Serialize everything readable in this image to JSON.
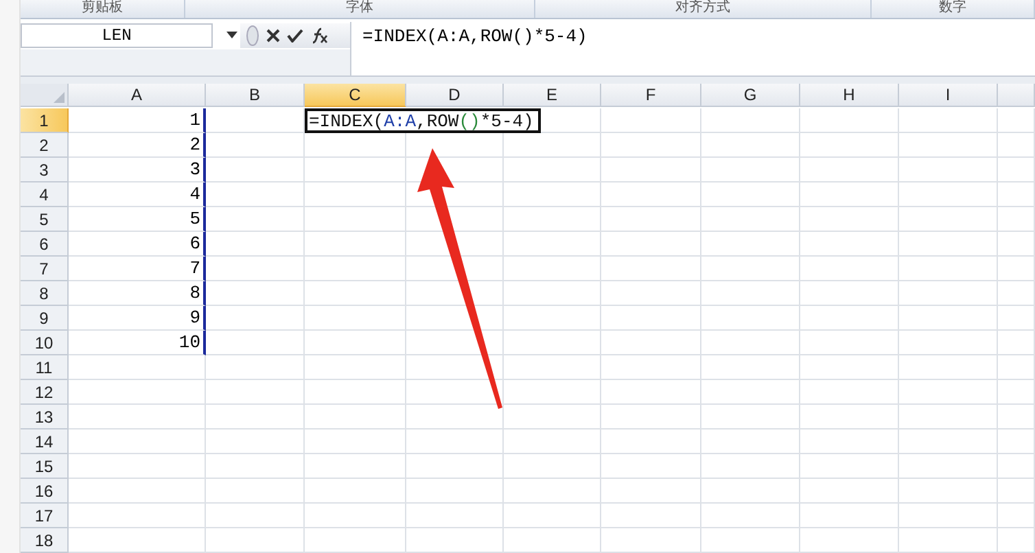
{
  "ribbon_groups": [
    "剪贴板",
    "字体",
    "对齐方式",
    "数字"
  ],
  "name_box": {
    "value": "LEN"
  },
  "formula_bar": {
    "value": "=INDEX(A:A,ROW()*5-4)"
  },
  "columns": [
    {
      "label": "A",
      "selected": false,
      "referenced": true
    },
    {
      "label": "B",
      "selected": false,
      "referenced": false
    },
    {
      "label": "C",
      "selected": true,
      "referenced": false
    },
    {
      "label": "D",
      "selected": false,
      "referenced": false
    },
    {
      "label": "E",
      "selected": false,
      "referenced": false
    },
    {
      "label": "F",
      "selected": false,
      "referenced": false
    },
    {
      "label": "G",
      "selected": false,
      "referenced": false
    },
    {
      "label": "H",
      "selected": false,
      "referenced": false
    },
    {
      "label": "I",
      "selected": false,
      "referenced": false
    }
  ],
  "rows": [
    {
      "label": "1",
      "selected": true,
      "cells": [
        {
          "kind": "value",
          "text": "1"
        },
        {
          "kind": "empty"
        },
        {
          "kind": "formula",
          "parts": [
            {
              "kind": "plain",
              "text": "=INDEX("
            },
            {
              "kind": "ref",
              "text": "A:A"
            },
            {
              "kind": "plain",
              "text": ",ROW"
            },
            {
              "kind": "paren",
              "text": "()"
            },
            {
              "kind": "plain",
              "text": "*5-4)"
            }
          ]
        }
      ]
    },
    {
      "label": "2",
      "selected": false,
      "cells": [
        {
          "kind": "value",
          "text": "2"
        }
      ]
    },
    {
      "label": "3",
      "selected": false,
      "cells": [
        {
          "kind": "value",
          "text": "3"
        }
      ]
    },
    {
      "label": "4",
      "selected": false,
      "cells": [
        {
          "kind": "value",
          "text": "4"
        }
      ]
    },
    {
      "label": "5",
      "selected": false,
      "cells": [
        {
          "kind": "value",
          "text": "5"
        }
      ]
    },
    {
      "label": "6",
      "selected": false,
      "cells": [
        {
          "kind": "value",
          "text": "6"
        }
      ]
    },
    {
      "label": "7",
      "selected": false,
      "cells": [
        {
          "kind": "value",
          "text": "7"
        }
      ]
    },
    {
      "label": "8",
      "selected": false,
      "cells": [
        {
          "kind": "value",
          "text": "8"
        }
      ]
    },
    {
      "label": "9",
      "selected": false,
      "cells": [
        {
          "kind": "value",
          "text": "9"
        }
      ]
    },
    {
      "label": "10",
      "selected": false,
      "cells": [
        {
          "kind": "value",
          "text": "10"
        }
      ]
    },
    {
      "label": "11",
      "selected": false,
      "cells": []
    },
    {
      "label": "12",
      "selected": false,
      "cells": []
    },
    {
      "label": "13",
      "selected": false,
      "cells": []
    },
    {
      "label": "14",
      "selected": false,
      "cells": []
    },
    {
      "label": "15",
      "selected": false,
      "cells": []
    },
    {
      "label": "16",
      "selected": false,
      "cells": []
    },
    {
      "label": "17",
      "selected": false,
      "cells": []
    },
    {
      "label": "18",
      "selected": false,
      "cells": []
    }
  ]
}
